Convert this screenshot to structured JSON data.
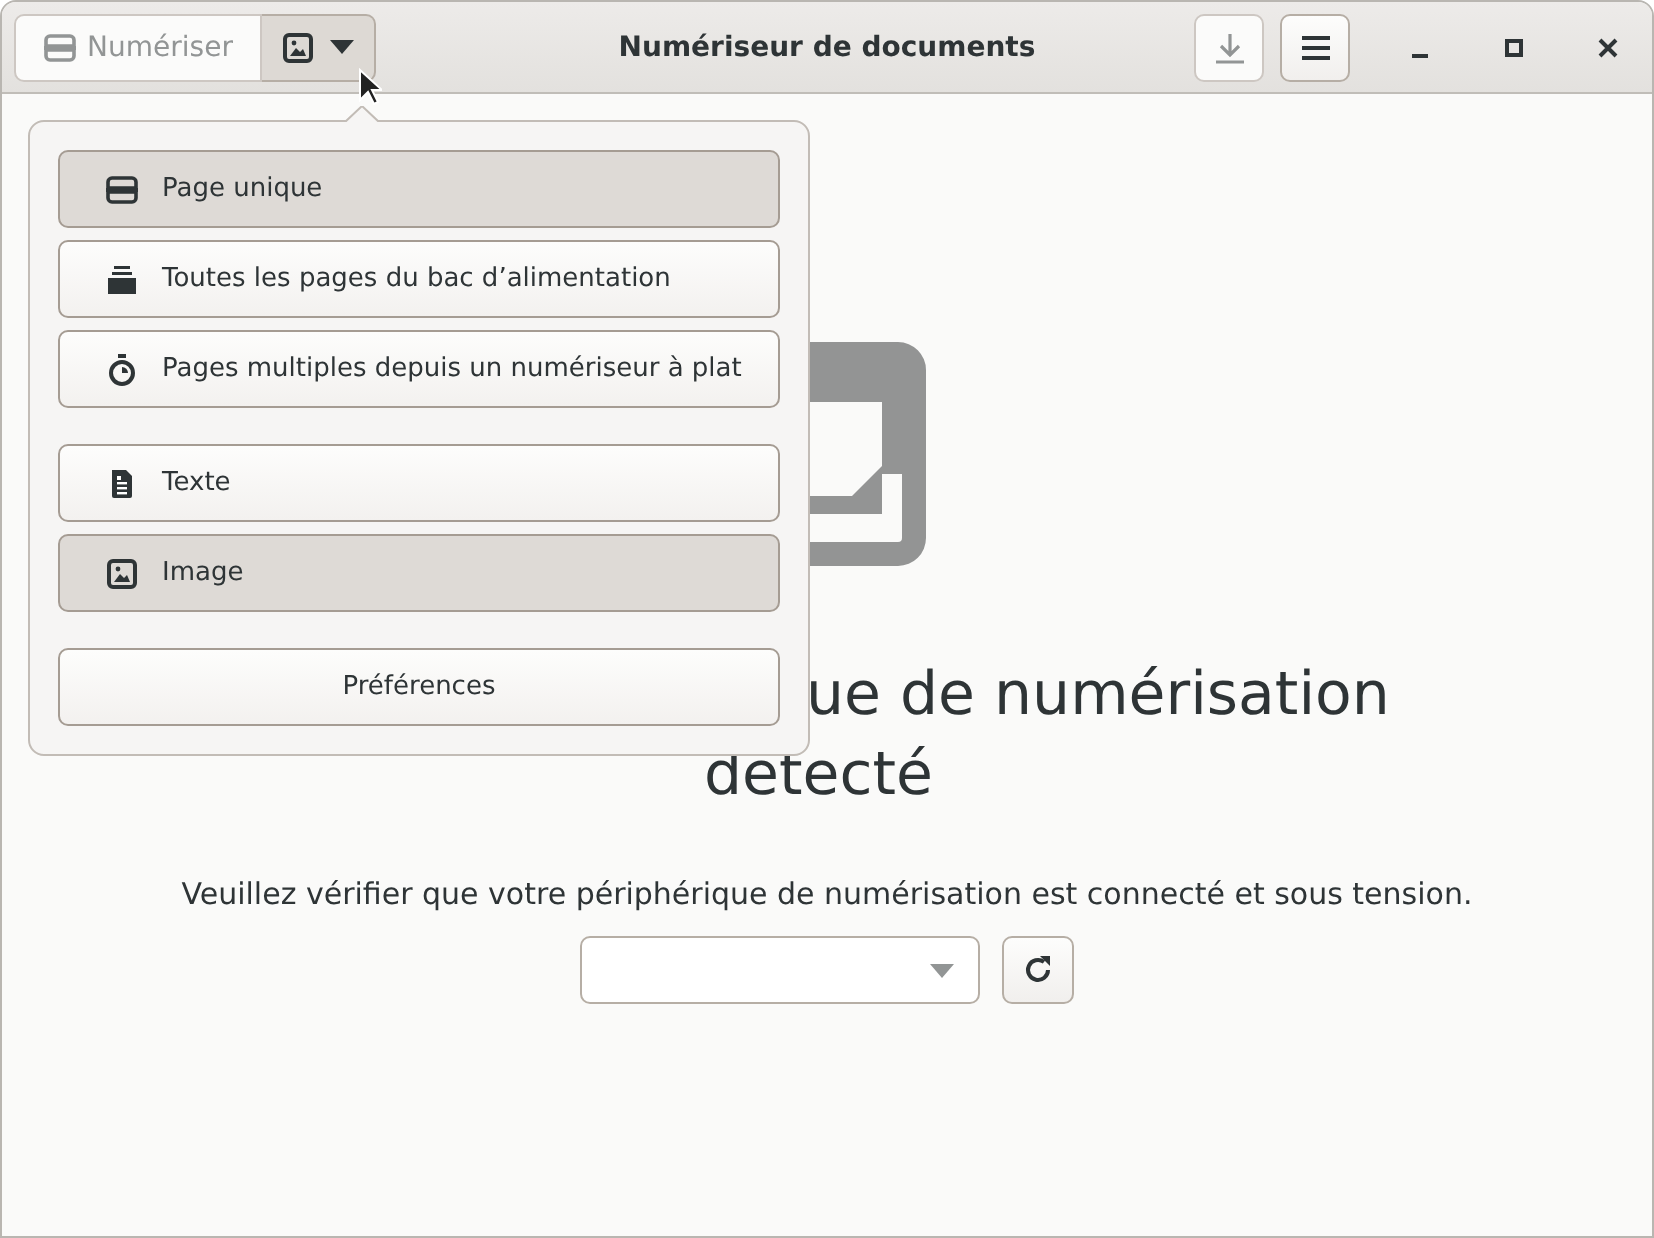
{
  "window": {
    "title": "Numériseur de documents"
  },
  "header": {
    "scan_button": {
      "label": "Numériser",
      "disabled": true
    },
    "download_button": {
      "disabled": true
    }
  },
  "popover": {
    "sections": [
      {
        "items": [
          {
            "label": "Page unique",
            "selected": true
          },
          {
            "label": "Toutes les pages du bac d’alimentation",
            "selected": false
          },
          {
            "label": "Pages multiples depuis un numériseur à plat",
            "selected": false
          }
        ]
      },
      {
        "items": [
          {
            "label": "Texte",
            "selected": false
          },
          {
            "label": "Image",
            "selected": true
          }
        ]
      },
      {
        "items": [
          {
            "label": "Préférences"
          }
        ]
      }
    ]
  },
  "empty_state": {
    "title_lines": [
      "ue de numérisation",
      "detecté"
    ],
    "message": "Veuillez vérifier que votre périphérique de numérisation est connecté et sous tension."
  }
}
